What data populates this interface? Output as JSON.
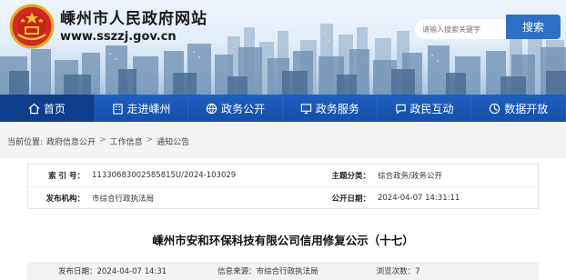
{
  "header": {
    "site_title": "嵊州市人民政府网站",
    "site_url": "www.sszzj.gov.cn",
    "search_placeholder": "请输入搜索关键字",
    "search_button": "搜索"
  },
  "nav": {
    "items": [
      {
        "label": "首页",
        "icon": "home-icon",
        "active": true
      },
      {
        "label": "走进嵊州",
        "icon": "building-icon"
      },
      {
        "label": "政务公开",
        "icon": "globe-icon"
      },
      {
        "label": "政务服务",
        "icon": "monitor-icon"
      },
      {
        "label": "政民互动",
        "icon": "chat-icon"
      },
      {
        "label": "数据开放",
        "icon": "data-icon"
      }
    ]
  },
  "breadcrumb": {
    "prefix": "当前位置:",
    "items": [
      "政府信息公开",
      "工作信息",
      "通知公告"
    ],
    "separator": ">"
  },
  "info": {
    "index_label": "索 引 号：",
    "index_value": "11330683002585815U/2024-103029",
    "category_label": "主题分类：",
    "category_value": "综合政务/政务公开",
    "publisher_label": "发布机构：",
    "publisher_value": "市综合行政执法局",
    "date_label": "公开日期：",
    "date_value": "2024-04-07 14:31:11"
  },
  "article": {
    "title": "嵊州市安和环保科技有限公司信用修复公示（十七）",
    "publish_date": "发布日期：2024-04-07 14:31",
    "source": "信息来源：市综合行政执法局",
    "views": "浏览次数：7"
  },
  "colors": {
    "nav_blue": "#1f5fc0",
    "nav_active": "#0f3f8c",
    "search_button": "#2f6fc6"
  }
}
